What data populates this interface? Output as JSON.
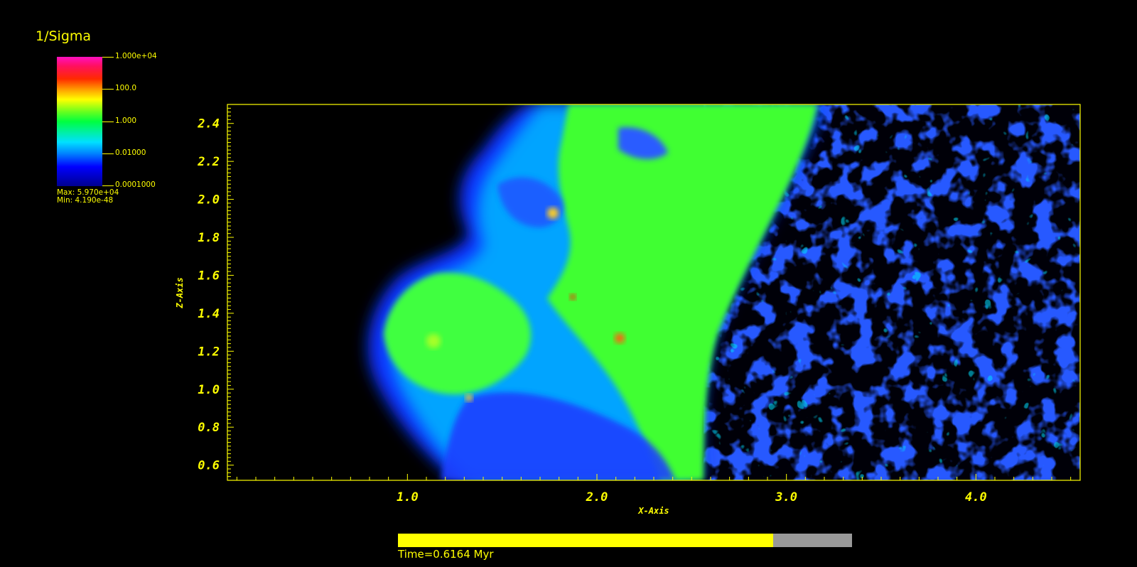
{
  "legend": {
    "title": "1/Sigma",
    "ticks": [
      "1.000e+04",
      "100.0",
      "1.000",
      "0.01000",
      "0.0001000"
    ],
    "max_label": "Max:  5.970e+04",
    "min_label": "Min:  4.190e-48"
  },
  "plot": {
    "xlabel": "X-Axis",
    "ylabel": "Z-Axis",
    "x_ticks": [
      "1.0",
      "2.0",
      "3.0",
      "4.0"
    ],
    "y_ticks": [
      "2.4",
      "2.2",
      "2.0",
      "1.8",
      "1.6",
      "1.4",
      "1.2",
      "1.0",
      "0.8",
      "0.6"
    ],
    "x_range": [
      0.05,
      4.55
    ],
    "y_range": [
      0.52,
      2.5
    ]
  },
  "time": {
    "label": "Time=0.6164 Myr",
    "progress_fraction": 0.826
  },
  "colors": {
    "text": "#ffff00",
    "background": "#000000",
    "bar_fill": "#ffff00",
    "bar_track": "#999999"
  }
}
